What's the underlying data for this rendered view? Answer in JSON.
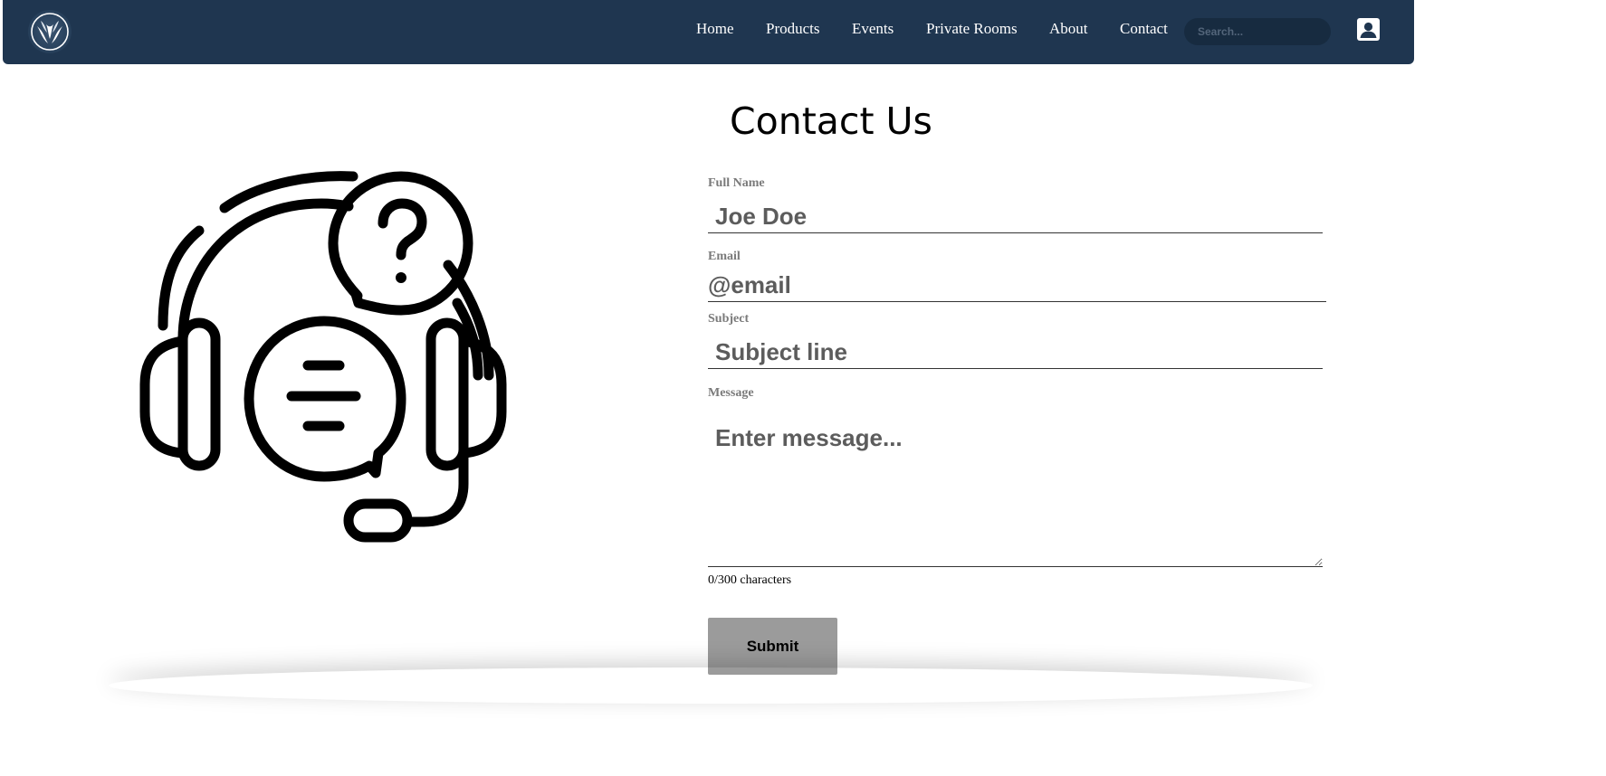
{
  "colors": {
    "navbar": "#1f3650",
    "search_bg": "#172b40",
    "submit_bg": "#9b9b9b",
    "label": "#7a7a7a"
  },
  "header": {
    "logo_icon": "wing-logo-icon",
    "nav": [
      {
        "label": "Home"
      },
      {
        "label": "Products"
      },
      {
        "label": "Events"
      },
      {
        "label": "Private Rooms"
      },
      {
        "label": "About"
      },
      {
        "label": "Contact"
      }
    ],
    "search": {
      "placeholder": "Search...",
      "value": ""
    },
    "account_icon": "account-icon"
  },
  "hero": {
    "icon": "headset-support-icon"
  },
  "form": {
    "title": "Contact Us",
    "full_name": {
      "label": "Full Name",
      "placeholder": "Joe Doe",
      "value": ""
    },
    "email": {
      "label": "Email",
      "placeholder": "@email",
      "value": ""
    },
    "subject": {
      "label": "Subject",
      "placeholder": "Subject line",
      "value": ""
    },
    "message": {
      "label": "Message",
      "placeholder": "Enter message...",
      "value": ""
    },
    "counter": "0/300 characters",
    "submit_label": "Submit"
  }
}
